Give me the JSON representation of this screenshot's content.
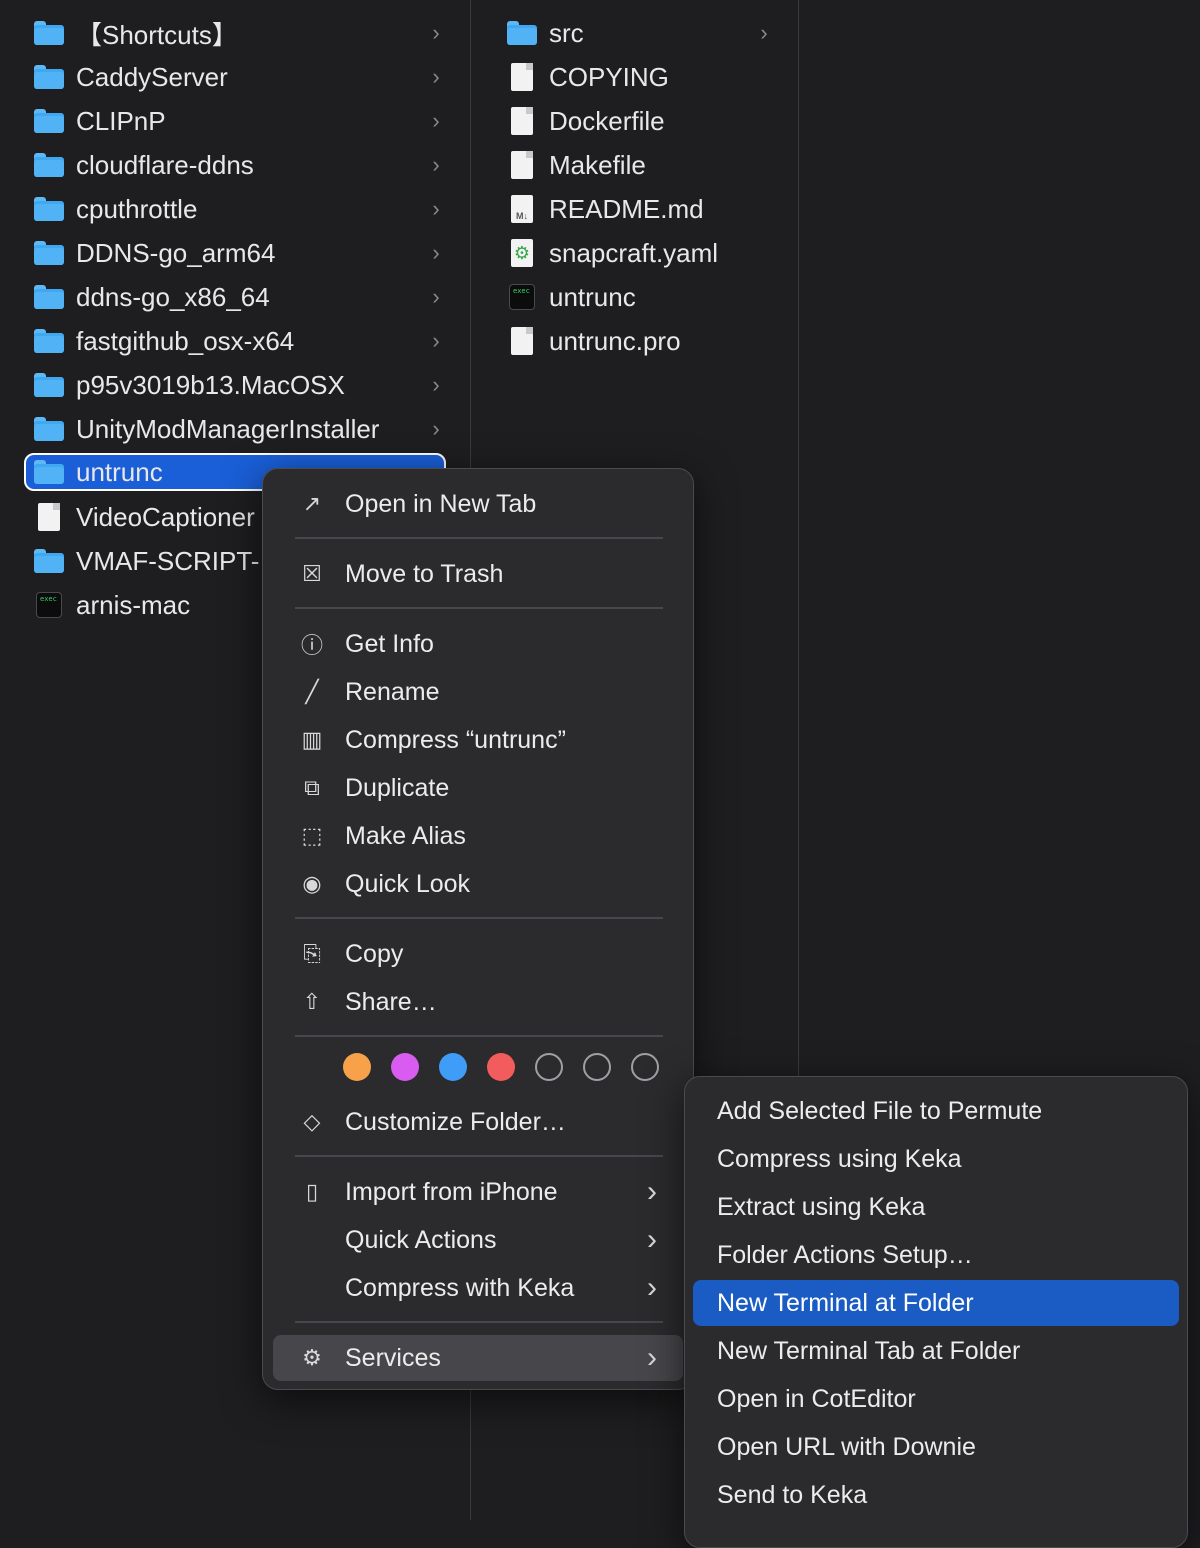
{
  "colors": {
    "selection": "#1a5fd8",
    "menu_bg": "#2b2b2e",
    "tag_orange": "#f7a14a",
    "tag_purple": "#d85cf0",
    "tag_blue": "#3f9cf7",
    "tag_red": "#f25c5c"
  },
  "column1": {
    "items": [
      {
        "label": "【Shortcuts】",
        "icon": "folder-icon",
        "chevron": "›"
      },
      {
        "label": "CaddyServer",
        "icon": "folder-icon",
        "chevron": "›"
      },
      {
        "label": "CLIPnP",
        "icon": "folder-icon",
        "chevron": "›"
      },
      {
        "label": "cloudflare-ddns",
        "icon": "folder-icon",
        "chevron": "›"
      },
      {
        "label": "cputhrottle",
        "icon": "folder-icon",
        "chevron": "›"
      },
      {
        "label": "DDNS-go_arm64",
        "icon": "folder-icon",
        "chevron": "›"
      },
      {
        "label": "ddns-go_x86_64",
        "icon": "folder-icon",
        "chevron": "›"
      },
      {
        "label": "fastgithub_osx-x64",
        "icon": "folder-icon",
        "chevron": "›"
      },
      {
        "label": "p95v3019b13.MacOSX",
        "icon": "folder-icon",
        "chevron": "›"
      },
      {
        "label": "UnityModManagerInstaller",
        "icon": "folder-icon",
        "chevron": "›"
      },
      {
        "label": "untrunc",
        "icon": "folder-icon",
        "chevron": "›"
      },
      {
        "label": "VideoCaptioner",
        "icon": "app-doc-icon",
        "chevron": ""
      },
      {
        "label": "VMAF-SCRIPT-",
        "icon": "folder-icon",
        "chevron": ""
      },
      {
        "label": "arnis-mac",
        "icon": "exec-icon",
        "chevron": ""
      }
    ]
  },
  "column2": {
    "items": [
      {
        "label": "src",
        "icon": "folder-icon",
        "chevron": "›"
      },
      {
        "label": "COPYING",
        "icon": "document-icon"
      },
      {
        "label": "Dockerfile",
        "icon": "document-icon"
      },
      {
        "label": "Makefile",
        "icon": "document-icon"
      },
      {
        "label": "README.md",
        "icon": "markdown-icon"
      },
      {
        "label": "snapcraft.yaml",
        "icon": "yaml-icon"
      },
      {
        "label": "untrunc",
        "icon": "exec-icon"
      },
      {
        "label": "untrunc.pro",
        "icon": "document-icon"
      }
    ],
    "exec_badge": "exec"
  },
  "context_menu": {
    "items": [
      {
        "label": "Open in New Tab",
        "icon": "open-new-tab-icon",
        "glyph": "↗"
      },
      {
        "label": "Move to Trash",
        "icon": "trash-icon",
        "glyph": "☒"
      },
      {
        "label": "Get Info",
        "icon": "info-icon",
        "glyph": "ⓘ"
      },
      {
        "label": "Rename",
        "icon": "pencil-icon",
        "glyph": "╱"
      },
      {
        "label": "Compress “untrunc”",
        "icon": "archive-icon",
        "glyph": "▥"
      },
      {
        "label": "Duplicate",
        "icon": "duplicate-icon",
        "glyph": "⧉"
      },
      {
        "label": "Make Alias",
        "icon": "alias-icon",
        "glyph": "⬚"
      },
      {
        "label": "Quick Look",
        "icon": "eye-icon",
        "glyph": "◉"
      },
      {
        "label": "Copy",
        "icon": "copy-icon",
        "glyph": "⎘"
      },
      {
        "label": "Share…",
        "icon": "share-icon",
        "glyph": "⇧"
      },
      {
        "label": "Customize Folder…",
        "icon": "tag-icon",
        "glyph": "◇"
      },
      {
        "label": "Import from iPhone",
        "icon": "iphone-icon",
        "glyph": "▯",
        "chevron": "›"
      },
      {
        "label": "Quick Actions",
        "icon": "",
        "glyph": "",
        "chevron": "›"
      },
      {
        "label": "Compress with Keka",
        "icon": "",
        "glyph": "",
        "chevron": "›"
      },
      {
        "label": "Services",
        "icon": "gears-icon",
        "glyph": "⚙",
        "chevron": "›"
      }
    ]
  },
  "services_menu": {
    "items": [
      {
        "label": "Add Selected File to Permute"
      },
      {
        "label": "Compress using Keka"
      },
      {
        "label": "Extract using Keka"
      },
      {
        "label": "Folder Actions Setup…"
      },
      {
        "label": "New Terminal at Folder"
      },
      {
        "label": "New Terminal Tab at Folder"
      },
      {
        "label": "Open in CotEditor"
      },
      {
        "label": "Open URL with Downie"
      },
      {
        "label": "Send to Keka"
      }
    ]
  }
}
